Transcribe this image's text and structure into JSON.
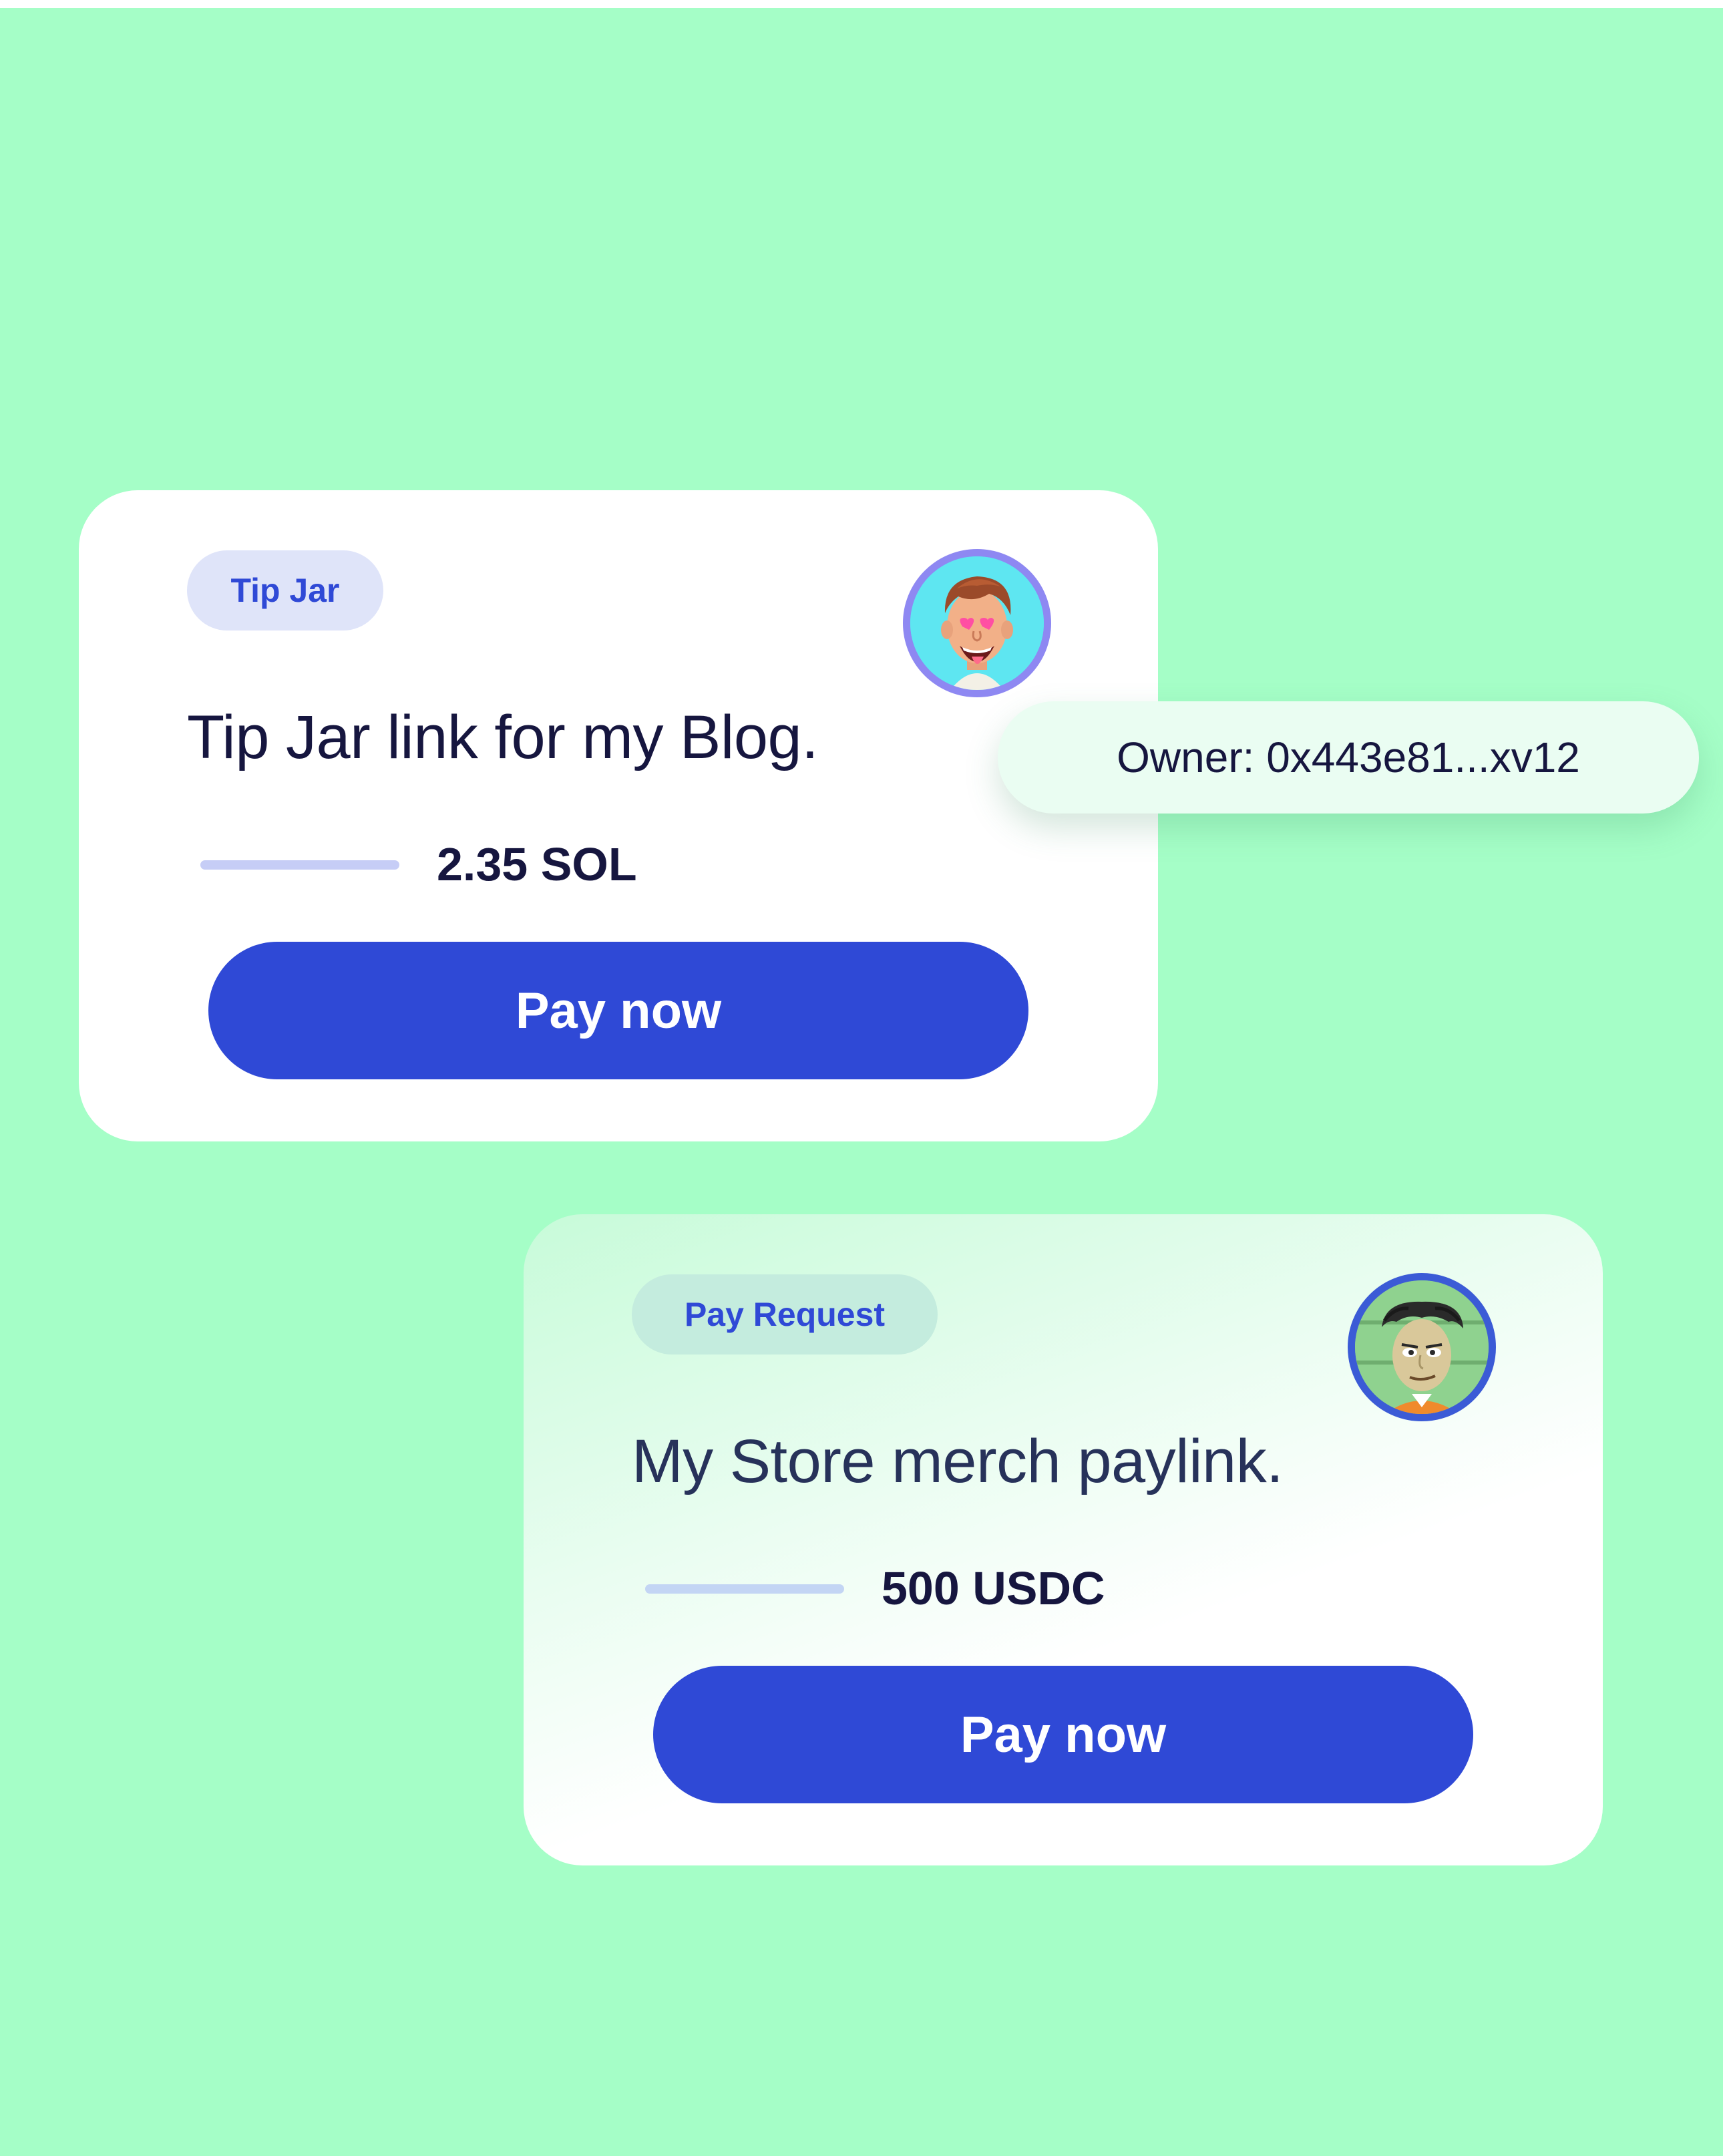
{
  "cards": [
    {
      "tag": "Tip Jar",
      "title": "Tip Jar link for my Blog.",
      "amount": "2.35 SOL",
      "button_label": "Pay now",
      "avatar_icon": "cartoon-man-heart-eyes-avatar"
    },
    {
      "tag": "Pay Request",
      "title": "My Store merch paylink.",
      "amount": "500 USDC",
      "button_label": "Pay now",
      "avatar_icon": "cartoon-old-man-avatar"
    }
  ],
  "owner": {
    "label": "Owner: 0x443e81...xv12"
  },
  "colors": {
    "background": "#a5fec7",
    "accent": "#2f49d6",
    "text_dark": "#16163f",
    "tag_tip_bg": "#dfe4f9",
    "tag_request_bg": "#c4ecde"
  }
}
